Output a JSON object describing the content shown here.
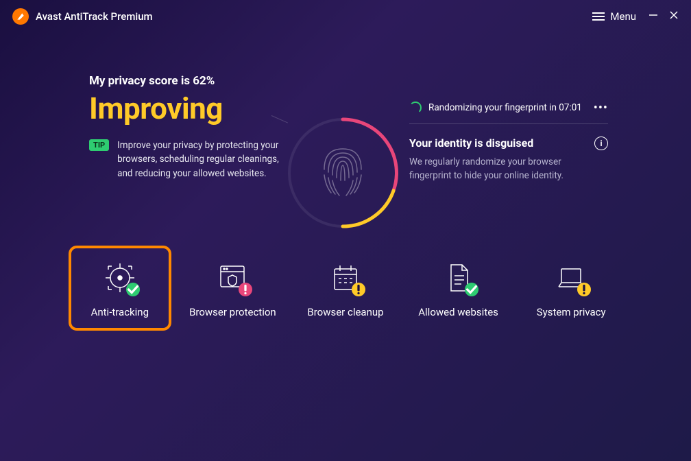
{
  "app": {
    "title": "Avast AntiTrack Premium"
  },
  "titlebar": {
    "menu_label": "Menu"
  },
  "score": {
    "label": "My privacy score is 62%",
    "status": "Improving",
    "tip_badge": "TIP",
    "tip_text": "Improve your privacy by protecting your browsers, scheduling regular cleanings, and reducing your allowed websites."
  },
  "randomize": {
    "text": "Randomizing your fingerprint in 07:01"
  },
  "identity": {
    "title": "Your identity is disguised",
    "desc": "We regularly randomize your browser fingerprint to hide your online identity.",
    "info_glyph": "i"
  },
  "cards": [
    {
      "label": "Anti-tracking"
    },
    {
      "label": "Browser protection"
    },
    {
      "label": "Browser cleanup"
    },
    {
      "label": "Allowed websites"
    },
    {
      "label": "System privacy"
    }
  ]
}
